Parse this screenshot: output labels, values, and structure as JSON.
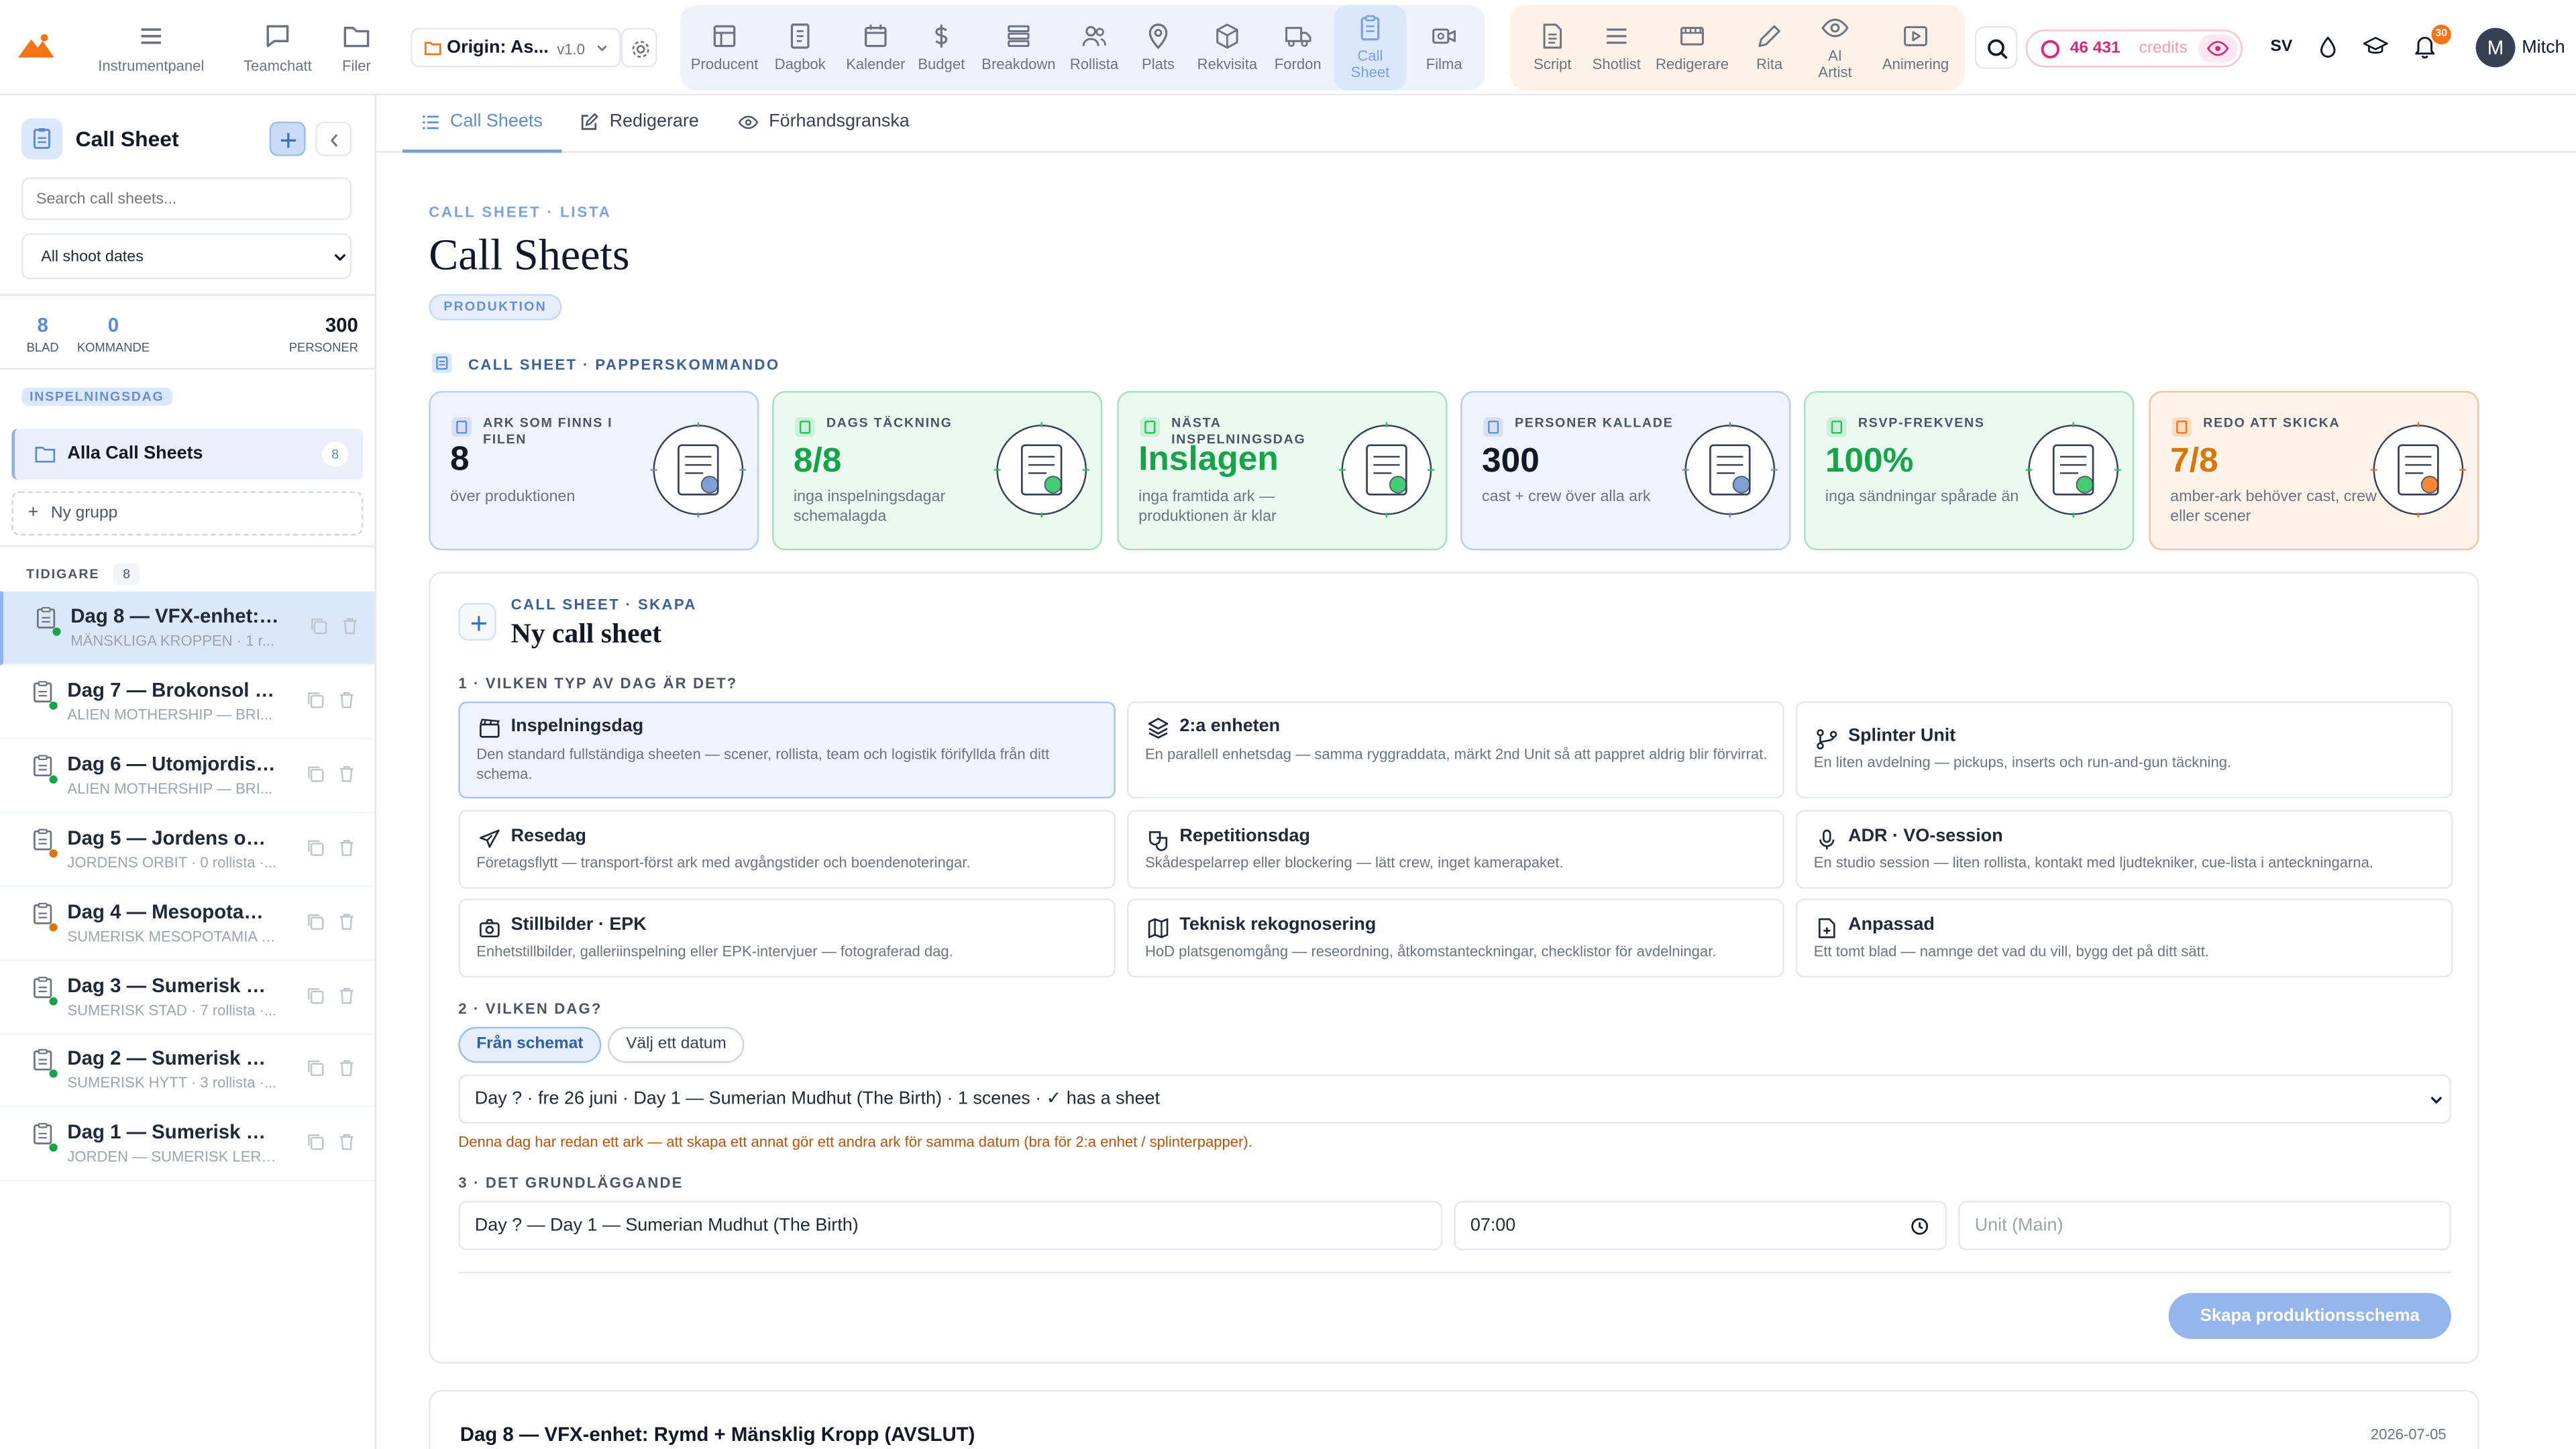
{
  "topbar": {
    "nav": [
      {
        "label": "Instrumentpanel",
        "icon": "hamburger-icon"
      },
      {
        "label": "Teamchatt",
        "icon": "chat-icon"
      },
      {
        "label": "Filer",
        "icon": "folder-icon"
      }
    ],
    "project": {
      "name": "Origin: As...",
      "version": "v1.0"
    },
    "group1": [
      {
        "label": "Producent",
        "icon": "grid-icon"
      },
      {
        "label": "Dagbok",
        "icon": "notebook-icon"
      },
      {
        "label": "Kalender",
        "icon": "calendar-icon"
      },
      {
        "label": "Budget",
        "icon": "dollar-icon"
      },
      {
        "label": "Breakdown",
        "icon": "layers-icon"
      },
      {
        "label": "Rollista",
        "icon": "people-icon"
      },
      {
        "label": "Plats",
        "icon": "pin-icon"
      },
      {
        "label": "Rekvisita",
        "icon": "box-icon"
      },
      {
        "label": "Fordon",
        "icon": "truck-icon"
      },
      {
        "label": "Call Sheet",
        "icon": "clipboard-icon",
        "active": true
      },
      {
        "label": "Filma",
        "icon": "video-icon"
      }
    ],
    "group2": [
      {
        "label": "Script",
        "icon": "document-icon"
      },
      {
        "label": "Shotlist",
        "icon": "list-icon"
      },
      {
        "label": "Redigerare",
        "icon": "film-icon"
      },
      {
        "label": "Rita",
        "icon": "pencil-icon"
      },
      {
        "label": "AI Artist",
        "icon": "eye-icon"
      },
      {
        "label": "Animering",
        "icon": "play-icon"
      }
    ],
    "credits_value": "46 431",
    "credits_label": "credits",
    "lang": "SV",
    "notif_count": "30",
    "user_initial": "M",
    "user_name": "Mitch"
  },
  "sidebar": {
    "title": "Call Sheet",
    "search_placeholder": "Search call sheets...",
    "date_filter": "All shoot dates",
    "stats": [
      {
        "value": "8",
        "label": "BLAD"
      },
      {
        "value": "0",
        "label": "KOMMANDE"
      },
      {
        "value": "300",
        "label": "PERSONER"
      }
    ],
    "section_badge": "INSPELNINGSDAG",
    "all_label": "Alla Call Sheets",
    "all_count": "8",
    "new_group": "Ny grupp",
    "earlier_label": "TIDIGARE",
    "earlier_count": "8",
    "items": [
      {
        "title": "Dag 8 — VFX-enhet: R...",
        "sub": "MÄNSKLIGA KROPPEN · 1 r...",
        "status": "green",
        "active": true
      },
      {
        "title": "Dag 7 — Brokonsol (\"...",
        "sub": "ALIEN MOTHERSHIP — BRI...",
        "status": "green"
      },
      {
        "title": "Dag 6 — Utomjordisk ...",
        "sub": "ALIEN MOTHERSHIP — BRI...",
        "status": "green"
      },
      {
        "title": "Dag 5 — Jordens omlo...",
        "sub": "JORDENS ORBIT · 0 rollista ·...",
        "status": "orange"
      },
      {
        "title": "Dag 4 — Mesopotami...",
        "sub": "SUMERISK MESOPOTAMIA ·...",
        "status": "orange"
      },
      {
        "title": "Dag 3 — Sumerisk Sta...",
        "sub": "SUMERISK STAD · 7 rollista ·...",
        "status": "green"
      },
      {
        "title": "Dag 2 — Sumerisk Hy...",
        "sub": "SUMERISK HYTT · 3 rollista ·...",
        "status": "green"
      },
      {
        "title": "Dag 1 — Sumerisk Ler...",
        "sub": "JORDEN — SUMERISK LERH...",
        "status": "green"
      }
    ]
  },
  "tabs": [
    {
      "label": "Call Sheets",
      "icon": "list-icon",
      "active": true
    },
    {
      "label": "Redigerare",
      "icon": "edit-icon"
    },
    {
      "label": "Förhandsgranska",
      "icon": "eye-icon"
    }
  ],
  "main": {
    "breadcrumb": "CALL SHEET · LISTA",
    "title": "Call Sheets",
    "badge": "PRODUKTION",
    "paper_label": "CALL SHEET · PAPPERSKOMMANDO",
    "stats": [
      {
        "label": "ARK SOM FINNS I FILEN",
        "value": "8",
        "sub": "över produktionen",
        "theme": "blue"
      },
      {
        "label": "DAGS TÄCKNING",
        "value": "8/8",
        "sub": "inga inspelningsdagar schemalagda",
        "theme": "green"
      },
      {
        "label": "NÄSTA INSPELNINGSDAG",
        "value": "Inslagen",
        "sub": "inga framtida ark — produktionen är klar",
        "theme": "green"
      },
      {
        "label": "PERSONER KALLADE",
        "value": "300",
        "sub": "cast + crew över alla ark",
        "theme": "blue"
      },
      {
        "label": "RSVP-FREKVENS",
        "value": "100%",
        "sub": "inga sändningar spårade än",
        "theme": "green"
      },
      {
        "label": "REDO ATT SKICKA",
        "value": "7/8",
        "sub": "amber-ark behöver cast, crew eller scener",
        "theme": "orange"
      }
    ],
    "create": {
      "eyebrow": "CALL SHEET · SKAPA",
      "title": "Ny call sheet",
      "step1": "1 · VILKEN TYP AV DAG ÄR DET?",
      "types": [
        {
          "title": "Inspelningsdag",
          "desc": "Den standard fullständiga sheeten — scener, rollista, team och logistik förifyllda från ditt schema.",
          "icon": "film-slate-icon",
          "selected": true
        },
        {
          "title": "2:a enheten",
          "desc": "En parallell enhetsdag — samma ryggraddata, märkt 2nd Unit så att pappret aldrig blir förvirrat.",
          "icon": "layers-icon"
        },
        {
          "title": "Splinter Unit",
          "desc": "En liten avdelning — pickups, inserts och run-and-gun täckning.",
          "icon": "branch-icon"
        },
        {
          "title": "Resedag",
          "desc": "Företagsflytt — transport-först ark med avgångstider och boendenoteringar.",
          "icon": "plane-icon"
        },
        {
          "title": "Repetitionsdag",
          "desc": "Skådespelarrep eller blockering — lätt crew, inget kamerapaket.",
          "icon": "mask-icon"
        },
        {
          "title": "ADR · VO-session",
          "desc": "En studio session — liten rollista, kontakt med ljudtekniker, cue-lista i anteckningarna.",
          "icon": "mic-icon"
        },
        {
          "title": "Stillbilder · EPK",
          "desc": "Enhetstillbilder, galleriinspelning eller EPK-intervjuer — fotograferad dag.",
          "icon": "camera-icon"
        },
        {
          "title": "Teknisk rekognosering",
          "desc": "HoD platsgenomgång — reseordning, åtkomstanteckningar, checklistor för avdelningar.",
          "icon": "map-icon"
        },
        {
          "title": "Anpassad",
          "desc": "Ett tomt blad — namnge det vad du vill, bygg det på ditt sätt.",
          "icon": "doc-plus-icon"
        }
      ],
      "step2": "2 · VILKEN DAG?",
      "day_from_schedule": "Från schemat",
      "day_pick": "Välj ett datum",
      "day_select": "Day ? · fre 26 juni · Day 1 — Sumerian Mudhut (The Birth) · 1 scenes · ✓ has a sheet",
      "warning": "Denna dag har redan ett ark — att skapa ett annat gör ett andra ark för samma datum (bra för 2:a enhet / splinterpapper).",
      "step3": "3 · DET GRUNDLÄGGANDE",
      "name_value": "Day ? — Day 1 — Sumerian Mudhut (The Birth)",
      "time_value": "07:00",
      "unit_placeholder": "Unit (Main)",
      "submit": "Skapa produktionsschema"
    },
    "recent": {
      "title": "Dag 8 — VFX-enhet: Rymd + Mänsklig Kropp (AVSLUT)",
      "date": "2026-07-05"
    }
  },
  "colors": {
    "accent": "#3b82f6",
    "accent_light": "#a9c4ef",
    "green": "#16a34a",
    "orange": "#d97706",
    "warning": "#b45309"
  }
}
